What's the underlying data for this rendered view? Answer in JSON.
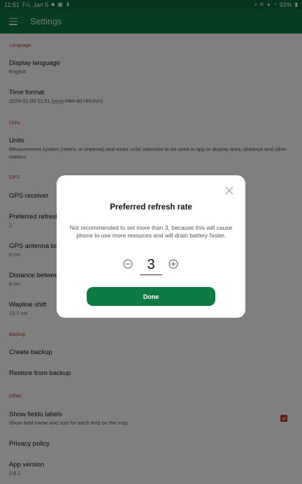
{
  "status_bar": {
    "time": "11:51",
    "date": "Fri, Jan 5",
    "battery": "93%"
  },
  "app_bar": {
    "title": "Settings"
  },
  "sections": {
    "language": {
      "header": "Language",
      "display_language": {
        "title": "Display language",
        "value": "English"
      },
      "time_format": {
        "title": "Time format",
        "value": "2024-01-05 11:51 (yyyy-MM-dd HH:mm)"
      }
    },
    "units": {
      "header": "Units",
      "units": {
        "title": "Units",
        "value": "Measurement system (metric or imperial) and exact units selection to be used in app to display area, distance and other metrics."
      }
    },
    "gps": {
      "header": "GPS",
      "gps_receiver": {
        "title": "GPS receiver"
      },
      "refresh_rate": {
        "title": "Preferred refresh rate",
        "value": "2"
      },
      "antenna": {
        "title": "GPS antenna location",
        "value": "0 cm"
      },
      "distance": {
        "title": "Distance between",
        "value": "0 cm"
      },
      "wayline_shift": {
        "title": "Wayline shift",
        "value": "12.7 cm"
      }
    },
    "backup": {
      "header": "Backup",
      "create": {
        "title": "Create backup"
      },
      "restore": {
        "title": "Restore from backup"
      }
    },
    "other": {
      "header": "Other",
      "field_labels": {
        "title": "Show fields labels",
        "value": "Show field name and size for each field on the map",
        "checked": true
      },
      "privacy": {
        "title": "Privacy policy"
      },
      "version": {
        "title": "App version",
        "value": "2.6.1"
      }
    }
  },
  "dialog": {
    "title": "Preferred refresh rate",
    "message": "Not recommended to set more than 3, because this will cause phone to use more resouces and will drain battery faster.",
    "value": "3",
    "done_label": "Done"
  },
  "colors": {
    "primary": "#0d7a43",
    "status_bar": "#0b6b3a",
    "accent_red": "#c0392b"
  }
}
